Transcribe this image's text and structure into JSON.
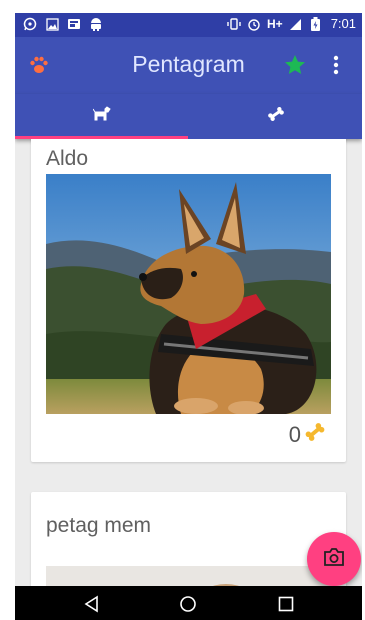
{
  "statusbar": {
    "network": "H+",
    "time": "7:01",
    "left_icons": [
      "whatsapp-icon",
      "image-icon",
      "app-icon",
      "android-icon"
    ],
    "right_icons": [
      "vibrate-icon",
      "alarm-icon",
      "signal-icon",
      "battery-icon"
    ]
  },
  "appbar": {
    "title": "Pentagram",
    "left_icon": "paw-icon",
    "actions": [
      "star-icon",
      "more-vert-icon"
    ]
  },
  "tabs": [
    {
      "icon": "dog-icon",
      "selected": true
    },
    {
      "icon": "bone-icon",
      "selected": false
    }
  ],
  "pets": [
    {
      "name": "Aldo",
      "likes": "0",
      "rating_icon": "bone-icon",
      "photo": "german-shepherd-photo"
    },
    {
      "name": "petag mem",
      "photo": "pet-photo"
    }
  ],
  "fab": {
    "icon": "camera-icon"
  },
  "navbar": {
    "buttons": [
      "back-icon",
      "home-icon",
      "recents-icon"
    ]
  },
  "colors": {
    "primary": "#3f51b5",
    "primary_dark": "#2f3ea6",
    "accent": "#ff4081",
    "star": "#1db954",
    "paw": "#ff6e40",
    "bone": "#f5b82e"
  }
}
